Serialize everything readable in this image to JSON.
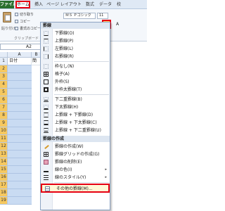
{
  "ribbon": {
    "tabs": [
      {
        "label": "ファイル"
      },
      {
        "label": "ホーム"
      },
      {
        "label": "挿入"
      },
      {
        "label": "ページ レイアウト"
      },
      {
        "label": "数式"
      },
      {
        "label": "データ"
      },
      {
        "label": "校"
      }
    ],
    "clipboard": {
      "paste_label": "貼り付け",
      "cut_label": "切り取り",
      "copy_label": "コピー",
      "format_painter_label": "書式のコピー/貼",
      "group_label": "クリップボード"
    },
    "font": {
      "name": "ＭＳ Ｐゴシック",
      "size": "11"
    }
  },
  "namebox": "A2",
  "sheet": {
    "columns": [
      "A",
      "B"
    ],
    "rows": [
      "1",
      "2",
      "3",
      "4",
      "5",
      "6",
      "7",
      "8",
      "9",
      "10",
      "11",
      "12",
      "13",
      "14",
      "15",
      "16",
      "17",
      "18",
      "19"
    ],
    "a1_value": "日付",
    "b1_value": "簡"
  },
  "menu": {
    "section_borders": "罫線",
    "items_borders": [
      {
        "label": "下罫線(O)"
      },
      {
        "label": "上罫線(P)"
      },
      {
        "label": "左罫線(L)"
      },
      {
        "label": "右罫線(R)"
      },
      {
        "label": "枠なし(N)"
      },
      {
        "label": "格子(A)"
      },
      {
        "label": "外枠(S)"
      },
      {
        "label": "外枠太罫線(T)"
      },
      {
        "label": "下二重罫線(B)"
      },
      {
        "label": "下太罫線(H)"
      },
      {
        "label": "上罫線 + 下罫線(D)"
      },
      {
        "label": "上罫線 + 下太罫線(C)"
      },
      {
        "label": "上罫線 + 下二重罫線(U)"
      }
    ],
    "section_draw": "罫線の作成",
    "items_draw": [
      {
        "label": "罫線の作成(W)"
      },
      {
        "label": "罫線グリッドの作成(G)"
      },
      {
        "label": "罫線の削除(E)"
      },
      {
        "label": "線の色(I)"
      },
      {
        "label": "線のスタイル(Y)"
      },
      {
        "label": "その他の罫線(M)..."
      }
    ]
  }
}
